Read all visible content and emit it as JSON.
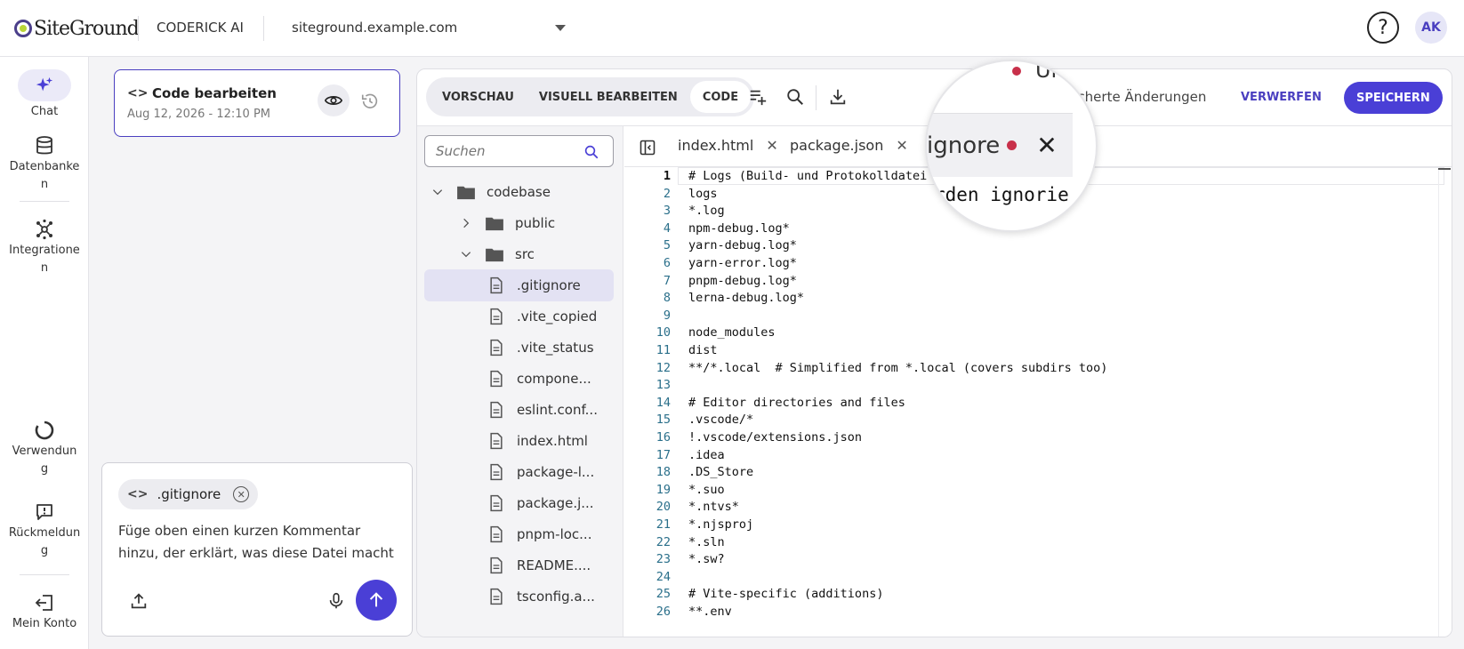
{
  "header": {
    "logo_text": "SiteGround",
    "app_name": "CODERICK AI",
    "site": "siteground.example.com",
    "help_label": "?",
    "avatar_initials": "AK"
  },
  "sidebar": {
    "items": [
      {
        "label": "Chat",
        "icon": "sparkle-icon"
      },
      {
        "label": "Datenbanke\nn",
        "icon": "database-icon"
      },
      {
        "label": "Integratione\nn",
        "icon": "network-icon"
      },
      {
        "label": "Verwendun\ng",
        "icon": "usage-icon"
      },
      {
        "label": "Rückmeldun\ng",
        "icon": "feedback-icon"
      },
      {
        "label": "Mein Konto",
        "icon": "logout-icon"
      }
    ]
  },
  "chat": {
    "card": {
      "title": "Code bearbeiten",
      "date": "Aug 12, 2026 - 12:10 PM"
    },
    "composer": {
      "chip_label": ".gitignore",
      "prompt": "Füge oben einen kurzen Kommentar hinzu, der erklärt, was diese Datei macht"
    }
  },
  "editor": {
    "tabs_mode": [
      {
        "label": "VORSCHAU",
        "active": false
      },
      {
        "label": "VISUELL BEARBEITEN",
        "active": false
      },
      {
        "label": "CODE",
        "active": true
      }
    ],
    "unsaved_text": "cicherte Änderungen",
    "discard_label": "VERWERFEN",
    "save_label": "SPEICHERN",
    "search_placeholder": "Suchen",
    "tree": [
      {
        "label": "codebase",
        "type": "folder",
        "depth": 0,
        "expanded": true
      },
      {
        "label": "public",
        "type": "folder",
        "depth": 1,
        "expanded": false
      },
      {
        "label": "src",
        "type": "folder",
        "depth": 1,
        "expanded": true
      },
      {
        "label": ".gitignore",
        "type": "file",
        "depth": 2,
        "selected": true
      },
      {
        "label": ".vite_copied",
        "type": "file",
        "depth": 2
      },
      {
        "label": ".vite_status",
        "type": "file",
        "depth": 2
      },
      {
        "label": "compone...",
        "type": "file",
        "depth": 2
      },
      {
        "label": "eslint.conf...",
        "type": "file",
        "depth": 2
      },
      {
        "label": "index.html",
        "type": "file",
        "depth": 2
      },
      {
        "label": "package-l...",
        "type": "file",
        "depth": 2
      },
      {
        "label": "package.j...",
        "type": "file",
        "depth": 2
      },
      {
        "label": "pnpm-loc...",
        "type": "file",
        "depth": 2
      },
      {
        "label": "README....",
        "type": "file",
        "depth": 2
      },
      {
        "label": "tsconfig.a...",
        "type": "file",
        "depth": 2
      }
    ],
    "open_tabs": [
      {
        "label": "index.html"
      },
      {
        "label": "package.json"
      }
    ],
    "code_lines": [
      "# Logs (Build- und Protokolldatei",
      "logs",
      "*.log",
      "npm-debug.log*",
      "yarn-debug.log*",
      "yarn-error.log*",
      "pnpm-debug.log*",
      "lerna-debug.log*",
      "",
      "node_modules",
      "dist",
      "**/*.local  # Simplified from *.local (covers subdirs too)",
      "",
      "# Editor directories and files",
      ".vscode/*",
      "!.vscode/extensions.json",
      ".idea",
      ".DS_Store",
      "*.suo",
      "*.ntvs*",
      "*.njsproj",
      "*.sln",
      "*.sw?",
      "",
      "# Vite-specific (additions)",
      "**.env"
    ],
    "magnifier": {
      "top_text": "Ur",
      "tab_label": "ignore",
      "close_glyph": "✕",
      "code_text": "rden ignorie"
    }
  },
  "colors": {
    "accent": "#4a3fd6",
    "unsaved_dot": "#c8304a"
  }
}
